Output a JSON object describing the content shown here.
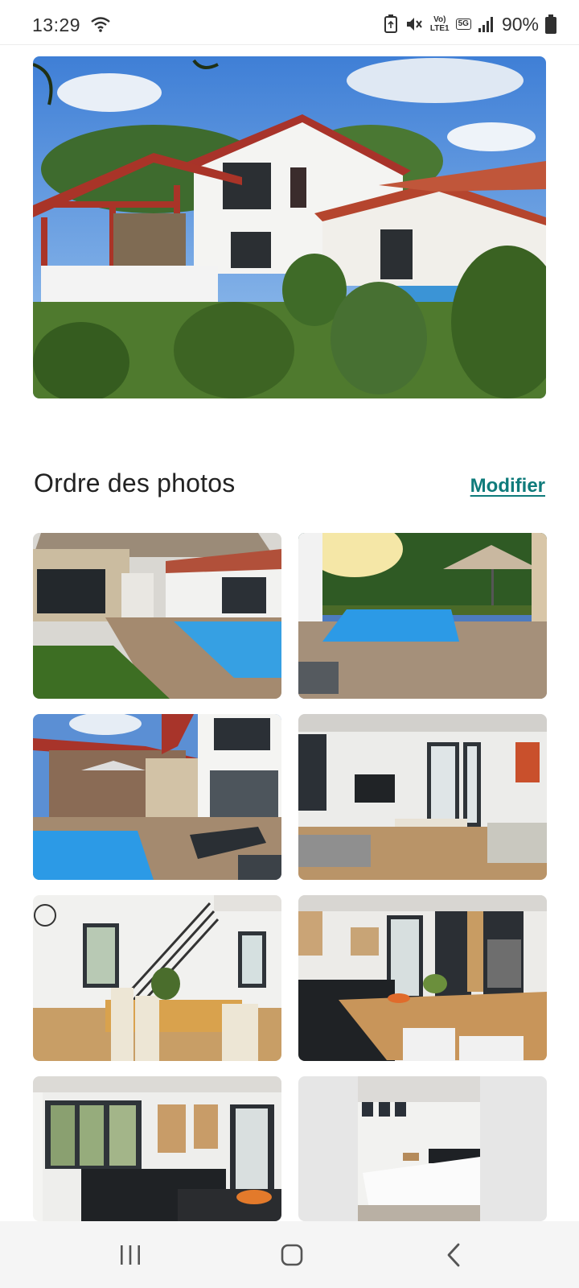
{
  "status_bar": {
    "time": "13:29",
    "network_top": "Vo)",
    "network_bottom": "LTE1",
    "network_type": "5G",
    "battery_percent": "90%",
    "icons": [
      "wifi-icon",
      "data-saver-icon",
      "mute-icon",
      "signal-icon",
      "battery-icon"
    ]
  },
  "hero_photo": {
    "description_icon": "house-exterior-photo"
  },
  "photo_order": {
    "title": "Ordre des photos",
    "modify_label": "Modifier"
  },
  "photos": [
    {
      "subject": "pool-terrace"
    },
    {
      "subject": "pool-deck"
    },
    {
      "subject": "pool-house"
    },
    {
      "subject": "living-room"
    },
    {
      "subject": "dining-staircase"
    },
    {
      "subject": "kitchen-island"
    },
    {
      "subject": "kitchen"
    },
    {
      "subject": "bedroom"
    }
  ],
  "navigation": {
    "buttons": [
      "recent-apps-icon",
      "home-icon",
      "back-icon"
    ]
  },
  "colors": {
    "accent_link": "#0f7b7b",
    "title_text": "#222222",
    "nav_bar_bg": "#f5f5f5"
  }
}
